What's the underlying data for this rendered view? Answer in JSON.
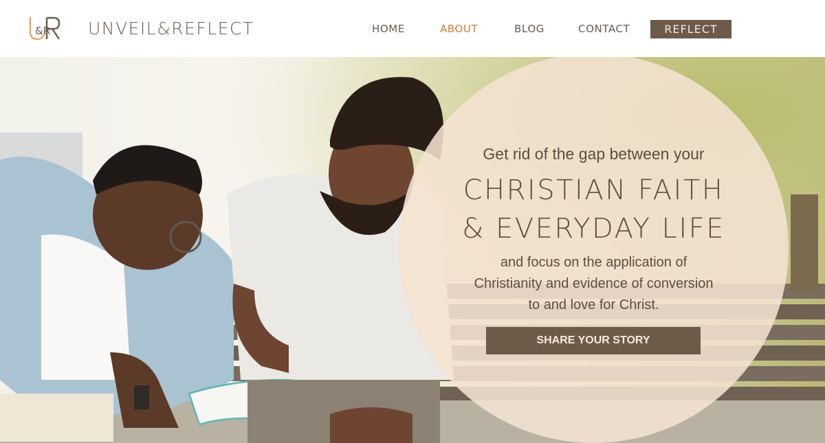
{
  "header": {
    "brand": "UNVEIL&REFLECT",
    "logo": {
      "icon": "ur-monogram-logo",
      "text": "&R"
    },
    "nav": [
      {
        "label": "HOME",
        "active": false
      },
      {
        "label": "ABOUT",
        "active": true
      },
      {
        "label": "BLOG",
        "active": false
      },
      {
        "label": "CONTACT",
        "active": false
      }
    ],
    "cta_label": "REFLECT"
  },
  "hero": {
    "image": "photo-two-men-reading-bible-on-park-bench",
    "lead": "Get rid of the gap between your",
    "heading_line1": "CHRISTIAN FAITH",
    "heading_line2": "& EVERYDAY LIFE",
    "body_line1": "and focus on the application of",
    "body_line2": "Christianity and evidence of conversion",
    "body_line3": "to and love for Christ.",
    "cta_label": "SHARE YOUR STORY"
  },
  "colors": {
    "brand_text": "#6b5a4c",
    "nav_active": "#d07a36",
    "button_bg": "#6e5a49",
    "circle_overlay": "#f4e2d2"
  }
}
